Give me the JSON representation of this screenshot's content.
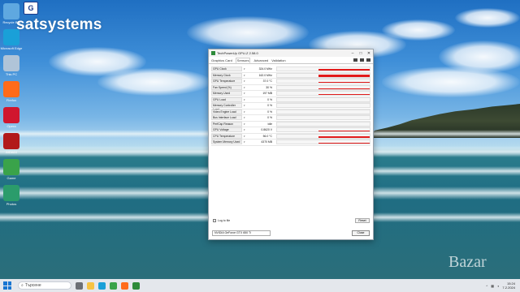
{
  "desktop": {
    "watermark_text": "satsystems",
    "watermark_logo_text": "G",
    "bottom_right_logo": "Bazar",
    "icons": [
      {
        "name": "recycle-bin-icon",
        "label": "Recycle Bin",
        "color": "#5fa8e0"
      },
      {
        "name": "microsoft-edge-icon",
        "label": "Microsoft Edge",
        "color": "#1aa0d8"
      },
      {
        "name": "computer-icon",
        "label": "This PC",
        "color": "#b0c4d8"
      },
      {
        "name": "firefox-icon",
        "label": "Firefox",
        "color": "#ff6b1a"
      },
      {
        "name": "opera-icon",
        "label": "Opera",
        "color": "#d0162e"
      },
      {
        "name": "aida64-icon",
        "label": "AIDA64",
        "color": "#b21a1a"
      },
      {
        "name": "game-icon",
        "label": "Game",
        "color": "#3aa34a"
      },
      {
        "name": "photo-icon",
        "label": "Photos",
        "color": "#2b9c6b"
      }
    ]
  },
  "window": {
    "title": "TechPowerUp GPU-Z 2.58.0",
    "tabs": [
      "Graphics Card",
      "Sensors",
      "Advanced",
      "Validation"
    ],
    "active_tab": "Sensors",
    "sensors": [
      {
        "label": "GPU Clock",
        "value": "324.0 MHz",
        "level": 0.6
      },
      {
        "label": "Memory Clock",
        "value": "162.0 MHz",
        "level": 0.7
      },
      {
        "label": "GPU Temperature",
        "value": "37.0 °C",
        "level": 0.25
      },
      {
        "label": "Fan Speed (%)",
        "value": "30 %",
        "level": 0.25
      },
      {
        "label": "Memory Used",
        "value": "197 MB",
        "level": 0.2
      },
      {
        "label": "GPU Load",
        "value": "0 %",
        "level": 0.05
      },
      {
        "label": "Memory Controller Load",
        "value": "0 %",
        "level": 0.05
      },
      {
        "label": "Video Engine Load",
        "value": "0 %",
        "level": 0.0
      },
      {
        "label": "Bus Interface Load",
        "value": "0 %",
        "level": 0.05
      },
      {
        "label": "PerfCap Reason",
        "value": "Idle",
        "level": 0.0
      },
      {
        "label": "GPU Voltage",
        "value": "0.8620 V",
        "level": 0.3
      },
      {
        "label": "CPU Temperature",
        "value": "56.0 °C",
        "level": 0.35
      },
      {
        "label": "System Memory Used",
        "value": "4370 MB",
        "level": 0.3
      }
    ],
    "log_to_file_label": "Log to file",
    "reset_label": "Reset",
    "device_select_value": "NVIDIA GeForce GTX 650 Ti",
    "close_label": "Close",
    "graph_color": "#e21b1b"
  },
  "taskbar": {
    "search_placeholder": "Търсене",
    "time": "15:24",
    "date": "7.2.2024"
  }
}
